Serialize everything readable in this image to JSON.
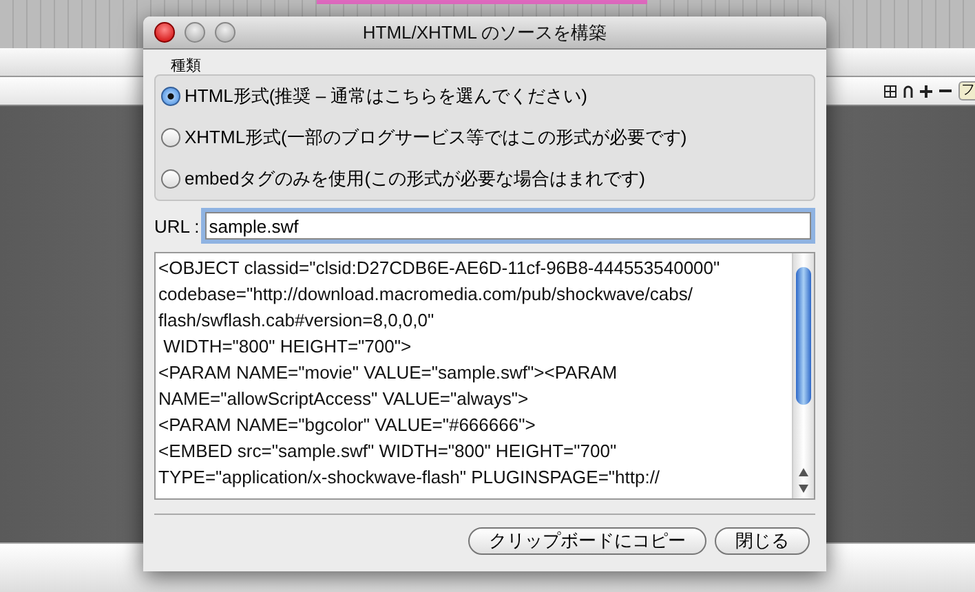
{
  "background_toolbar": {
    "button_label": "フ"
  },
  "dialog": {
    "title": "HTML/XHTML のソースを構築",
    "group_label": "種類",
    "format_options": [
      {
        "label": "HTML形式(推奨 – 通常はこちらを選んでください)",
        "selected": true
      },
      {
        "label": "XHTML形式(一部のブログサービス等ではこの形式が必要です)",
        "selected": false
      },
      {
        "label": "embedタグのみを使用(この形式が必要な場合はまれです)",
        "selected": false
      }
    ],
    "url": {
      "label": "URL :",
      "value": "sample.swf"
    },
    "source_lines": [
      "<OBJECT classid=\"clsid:D27CDB6E-AE6D-11cf-96B8-444553540000\"",
      "codebase=\"http://download.macromedia.com/pub/shockwave/cabs/",
      "flash/swflash.cab#version=8,0,0,0\"",
      " WIDTH=\"800\" HEIGHT=\"700\">",
      "<PARAM NAME=\"movie\" VALUE=\"sample.swf\"><PARAM",
      "NAME=\"allowScriptAccess\" VALUE=\"always\">",
      "<PARAM NAME=\"bgcolor\" VALUE=\"#666666\">",
      "<EMBED src=\"sample.swf\" WIDTH=\"800\" HEIGHT=\"700\"",
      "TYPE=\"application/x-shockwave-flash\" PLUGINSPAGE=\"http://"
    ],
    "buttons": [
      "クリップボードにコピー",
      "閉じる"
    ]
  }
}
